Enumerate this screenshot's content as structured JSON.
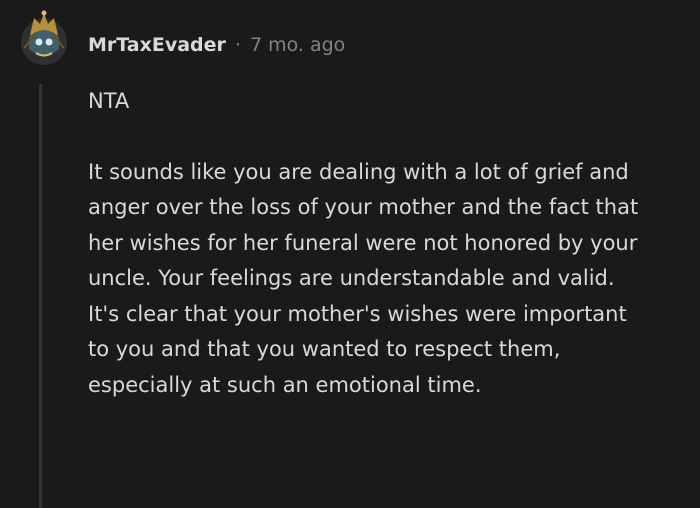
{
  "comment": {
    "author": "MrTaxEvader",
    "separator": "·",
    "timestamp": "7 mo. ago",
    "paragraphs": [
      "NTA",
      "It sounds like you are dealing with a lot of grief and anger over the loss of your mother and the fact that her wishes for her funeral were not honored by your uncle. Your feelings are understandable and valid. It's clear that your mother's wishes were important to you and that you wanted to respect them, especially at such an emotional time."
    ]
  },
  "colors": {
    "background": "#1a1a1b",
    "text": "#d7dadc",
    "muted": "#818384",
    "thread_line": "#343536"
  },
  "icons": {
    "avatar": "user-avatar-icon"
  }
}
